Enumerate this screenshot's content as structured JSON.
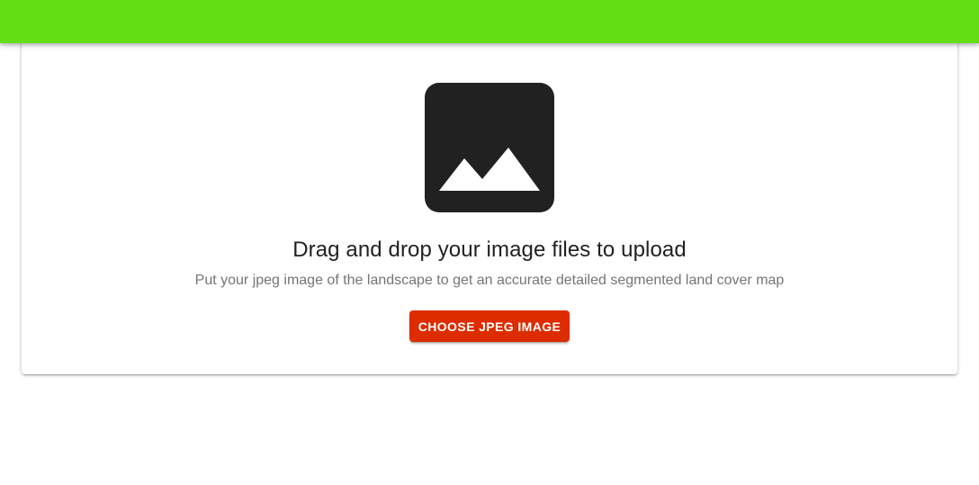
{
  "colors": {
    "app_bar": "#62e015",
    "button": "#dd2c00",
    "icon": "#212121"
  },
  "upload": {
    "icon": "image-icon",
    "title": "Drag and drop your image files to upload",
    "description": "Put your jpeg image of the landscape to get an accurate detailed segmented land cover map",
    "button_label": "CHOOSE JPEG IMAGE"
  }
}
